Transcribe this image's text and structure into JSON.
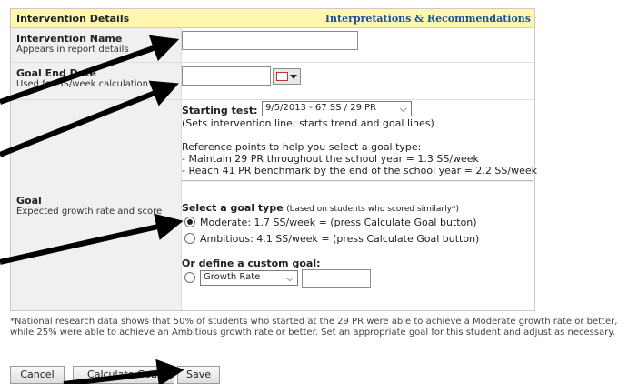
{
  "header": {
    "title": "Intervention Details",
    "link": "Interpretations & Recommendations"
  },
  "fields": {
    "intervention_name": {
      "label": "Intervention Name",
      "sub": "Appears in report details",
      "value": ""
    },
    "goal_rate": {
      "label": "Goal End Date",
      "sub": "Used for SS/week calculation",
      "value": ""
    },
    "goal": {
      "label": "Goal",
      "sub": "Expected growth rate and score"
    }
  },
  "starting_test": {
    "label": "Starting test:",
    "selected": "9/5/2013 - 67 SS / 29 PR",
    "note": "(Sets intervention line; starts trend and goal lines)"
  },
  "reference": {
    "intro": "Reference points to help you select a goal type:",
    "points": [
      "- Maintain 29 PR throughout the school year = 1.3 SS/week",
      "- Reach 41 PR benchmark by the end of the school year = 2.2 SS/week"
    ]
  },
  "goal_type": {
    "label": "Select a goal type",
    "hint": "(based on students who scored similarly*)",
    "options": [
      {
        "text": "Moderate: 1.7 SS/week = (press Calculate Goal button)",
        "checked": true
      },
      {
        "text": "Ambitious: 4.1 SS/week = (press Calculate Goal button)",
        "checked": false
      }
    ]
  },
  "custom_goal": {
    "label": "Or define a custom goal:",
    "type_selected": "Growth Rate",
    "value": ""
  },
  "footnote": "*National research data shows that 50% of students who started at the 29 PR were able to achieve a Moderate growth rate or better, while 25% were able to achieve an Ambitious growth rate or better. Set an appropriate goal for this student and adjust as necessary.",
  "buttons": {
    "cancel": "Cancel",
    "calculate": "Calculate Goal",
    "save": "Save"
  },
  "colors": {
    "header_bg": "#fff6b0",
    "link": "#1b4f9a",
    "label_bg": "#f0f0f0",
    "arrow": "#000000"
  }
}
